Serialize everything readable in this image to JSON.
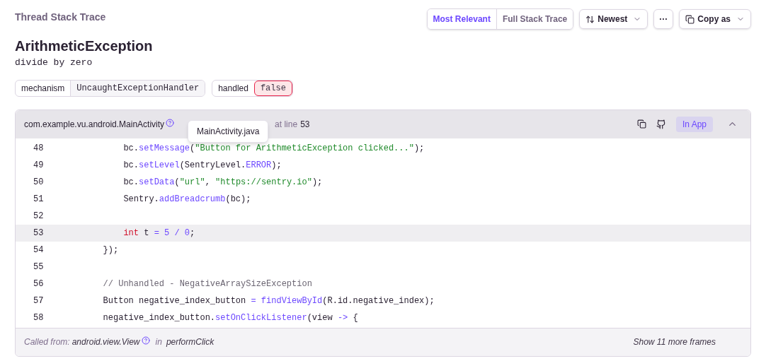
{
  "section_title": "Thread Stack Trace",
  "view_tabs": [
    {
      "label": "Most Relevant",
      "selected": true
    },
    {
      "label": "Full Stack Trace",
      "selected": false
    }
  ],
  "sort_button": {
    "label": "Newest"
  },
  "more_button": {
    "label": "···"
  },
  "copy_button": {
    "label": "Copy as"
  },
  "exception": {
    "type": "ArithmeticException",
    "message": "divide by zero"
  },
  "tags": [
    {
      "key": "mechanism",
      "value": "UncaughtExceptionHandler",
      "highlighted": false
    },
    {
      "key": "handled",
      "value": "false",
      "highlighted": true
    }
  ],
  "frame": {
    "module": "com.example.vu.android.MainActivity",
    "line_label": "at line",
    "line": "53",
    "in_app": {
      "label": "In App"
    },
    "expanded": true,
    "tooltip": "MainActivity.java",
    "code_lines": [
      {
        "number": "48",
        "selected": false,
        "tokens": [
          {
            "kind": "plain",
            "text": "            bc."
          },
          {
            "kind": "method",
            "text": "setMessage"
          },
          {
            "kind": "plain",
            "text": "("
          },
          {
            "kind": "string",
            "text": "\"Button for ArithmeticException clicked...\""
          },
          {
            "kind": "plain",
            "text": ");"
          }
        ]
      },
      {
        "number": "49",
        "selected": false,
        "tokens": [
          {
            "kind": "plain",
            "text": "            bc."
          },
          {
            "kind": "method",
            "text": "setLevel"
          },
          {
            "kind": "plain",
            "text": "(SentryLevel."
          },
          {
            "kind": "method",
            "text": "ERROR"
          },
          {
            "kind": "plain",
            "text": ");"
          }
        ]
      },
      {
        "number": "50",
        "selected": false,
        "tokens": [
          {
            "kind": "plain",
            "text": "            bc."
          },
          {
            "kind": "method",
            "text": "setData"
          },
          {
            "kind": "plain",
            "text": "("
          },
          {
            "kind": "string",
            "text": "\"url\""
          },
          {
            "kind": "plain",
            "text": ", "
          },
          {
            "kind": "string",
            "text": "\"https://sentry.io\""
          },
          {
            "kind": "plain",
            "text": ");"
          }
        ]
      },
      {
        "number": "51",
        "selected": false,
        "tokens": [
          {
            "kind": "plain",
            "text": "            Sentry."
          },
          {
            "kind": "method",
            "text": "addBreadcrumb"
          },
          {
            "kind": "plain",
            "text": "(bc);"
          }
        ]
      },
      {
        "number": "52",
        "selected": false
      },
      {
        "number": "53",
        "selected": true,
        "tokens": [
          {
            "kind": "keyword",
            "text": "            int"
          },
          {
            "kind": "plain",
            "text": " t "
          },
          {
            "kind": "method",
            "text": "= 5 / 0"
          },
          {
            "kind": "plain",
            "text": ";"
          }
        ]
      },
      {
        "number": "54",
        "selected": false,
        "tokens": [
          {
            "kind": "plain",
            "text": "        });"
          }
        ]
      },
      {
        "number": "55",
        "selected": false
      },
      {
        "number": "56",
        "selected": false,
        "tokens": [
          {
            "kind": "comment",
            "text": "        // Unhandled - NegativeArraySizeException"
          }
        ]
      },
      {
        "number": "57",
        "selected": false,
        "tokens": [
          {
            "kind": "plain",
            "text": "        Button negative_index_button "
          },
          {
            "kind": "method",
            "text": "= findViewById"
          },
          {
            "kind": "plain",
            "text": "(R.id.negative_index);"
          }
        ]
      },
      {
        "number": "58",
        "selected": false,
        "tokens": [
          {
            "kind": "plain",
            "text": "        negative_index_button."
          },
          {
            "kind": "method",
            "text": "setOnClickListener"
          },
          {
            "kind": "plain",
            "text": "(view "
          },
          {
            "kind": "method",
            "text": "->"
          },
          {
            "kind": "plain",
            "text": " {"
          }
        ]
      }
    ]
  },
  "footer": {
    "called_from_label": "Called from:",
    "called_from": "android.view.View",
    "in_label": "in",
    "function": "performClick",
    "more_frames": "Show 11 more frames"
  }
}
